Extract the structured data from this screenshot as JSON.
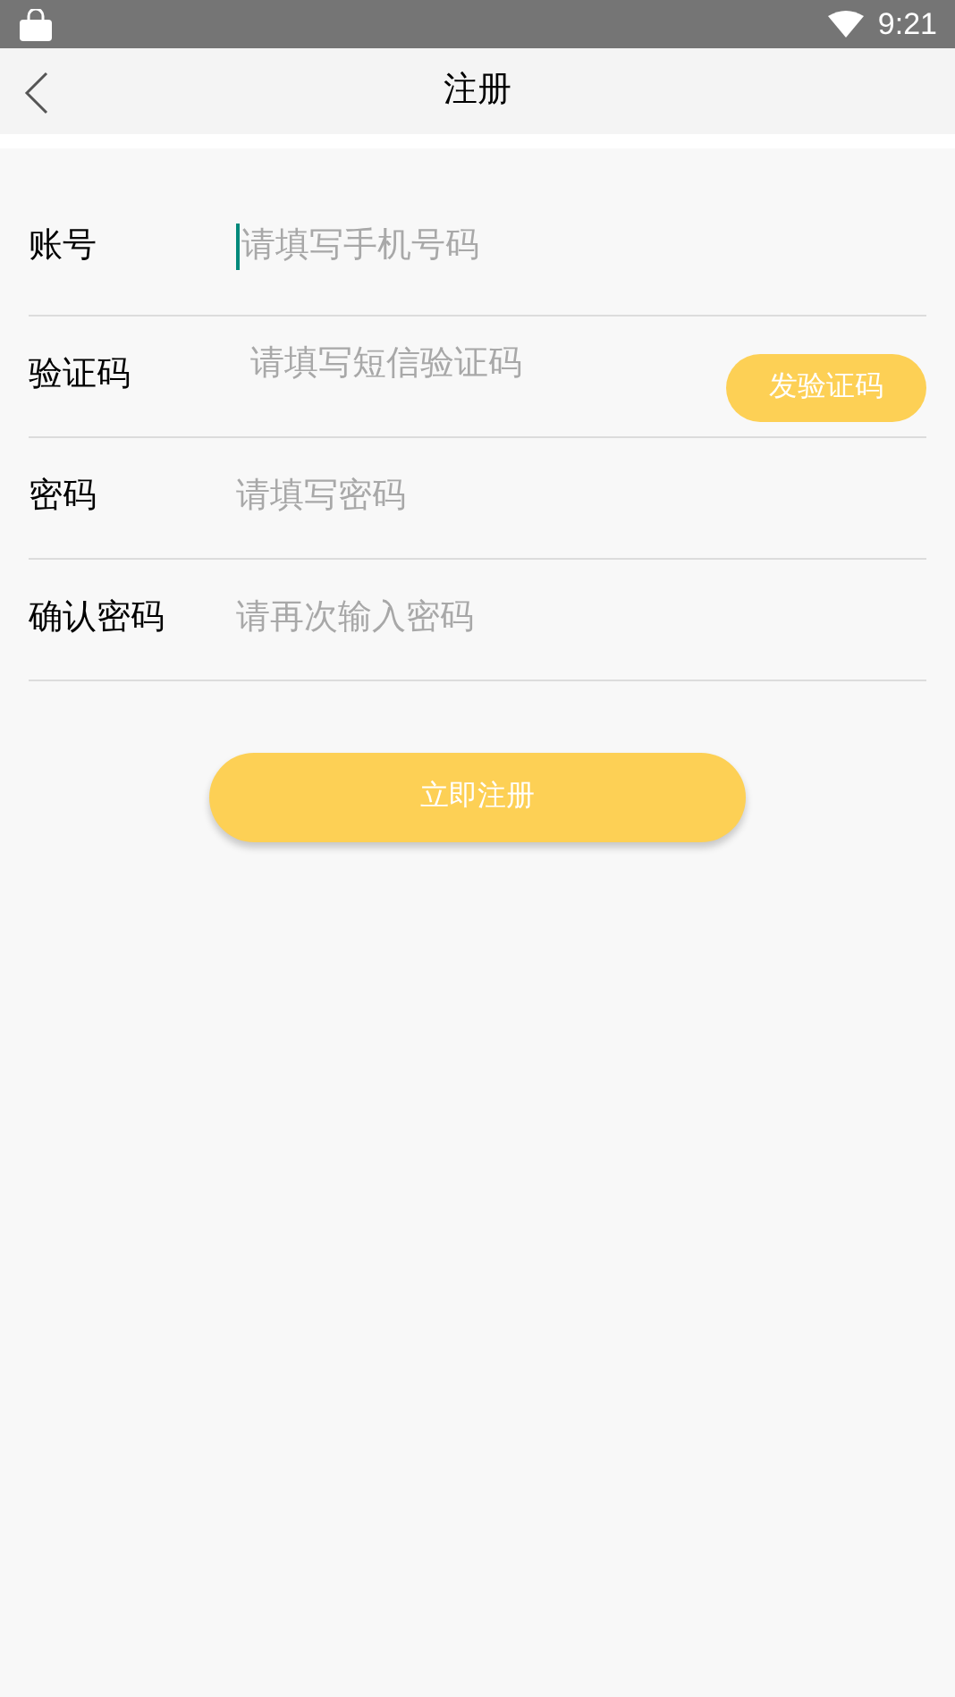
{
  "status_bar": {
    "time": "9:21"
  },
  "header": {
    "title": "注册"
  },
  "fields": [
    {
      "kind": "text",
      "label": "账号",
      "placeholder": "请填写手机号码",
      "focused": true
    },
    {
      "kind": "code",
      "label": "验证码",
      "placeholder": "请填写短信验证码",
      "focused": false,
      "button": "发验证码"
    },
    {
      "kind": "text",
      "label": "密码",
      "placeholder": "请填写密码",
      "focused": false
    },
    {
      "kind": "text",
      "label": "确认密码",
      "placeholder": "请再次输入密码",
      "focused": false
    }
  ],
  "submit": "立即注册"
}
